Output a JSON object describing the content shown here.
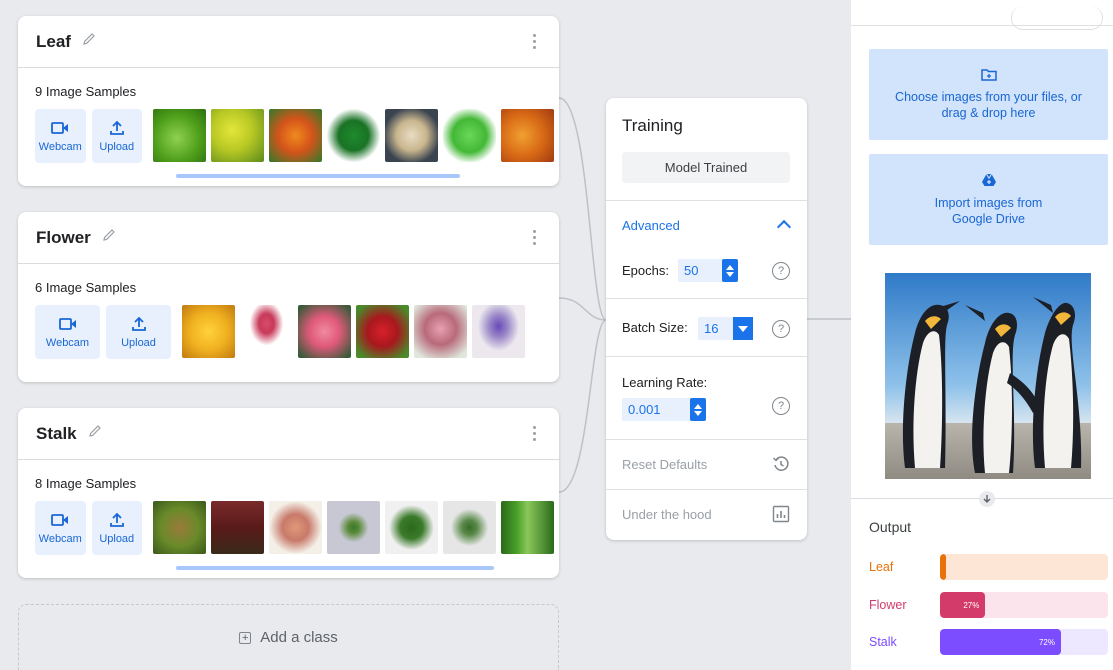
{
  "classes": [
    {
      "name": "Leaf",
      "samples": "9 Image Samples",
      "webcam_label": "Webcam",
      "upload_label": "Upload"
    },
    {
      "name": "Flower",
      "samples": "6 Image Samples",
      "webcam_label": "Webcam",
      "upload_label": "Upload"
    },
    {
      "name": "Stalk",
      "samples": "8 Image Samples",
      "webcam_label": "Webcam",
      "upload_label": "Upload"
    }
  ],
  "add_class_label": "Add a class",
  "training": {
    "title": "Training",
    "status_button": "Model Trained",
    "advanced_label": "Advanced",
    "epochs_label": "Epochs:",
    "epochs_value": "50",
    "batch_size_label": "Batch Size:",
    "batch_size_value": "16",
    "learning_rate_label": "Learning Rate:",
    "learning_rate_value": "0.001",
    "reset_label": "Reset Defaults",
    "under_hood_label": "Under the hood",
    "help_glyph": "?"
  },
  "preview": {
    "choose_files_text": "Choose images from your files, or drag & drop here",
    "drive_text": "Import images from Google Drive"
  },
  "output": {
    "title": "Output",
    "rows": [
      {
        "label": "Leaf",
        "value": 0.01,
        "text": "",
        "color": "#e8710a",
        "track": "#fde6d6"
      },
      {
        "label": "Flower",
        "value": 0.27,
        "text": "27%",
        "color": "#d33b6b",
        "track": "#fce4ec"
      },
      {
        "label": "Stalk",
        "value": 0.72,
        "text": "72%",
        "color": "#7c4dff",
        "track": "#ede7ff"
      }
    ]
  },
  "colors": {
    "accent": "#1a73e8",
    "tile": "#e8f0fe"
  }
}
